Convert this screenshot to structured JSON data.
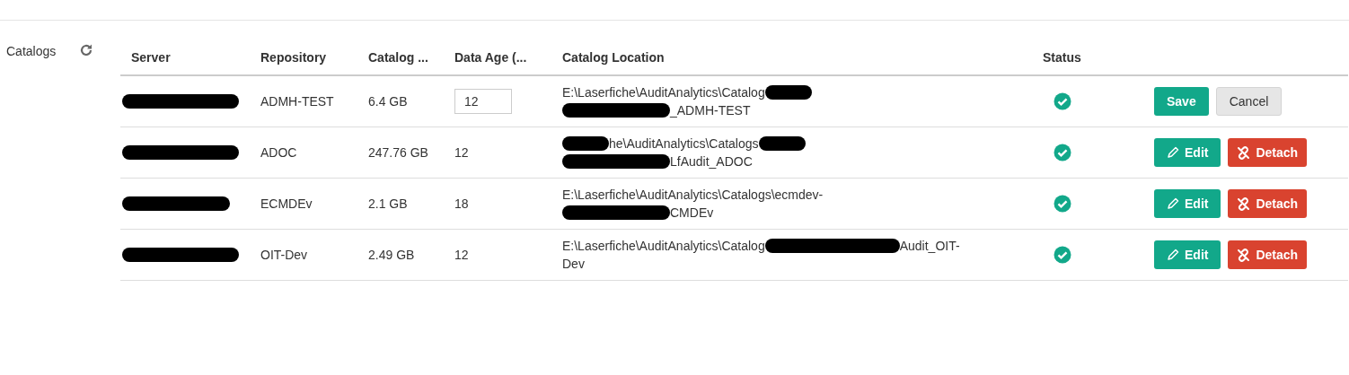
{
  "section": {
    "title": "Catalogs"
  },
  "table": {
    "columns": [
      "Server",
      "Repository",
      "Catalog ...",
      "Data Age (...",
      "Catalog Location",
      "Status"
    ],
    "rows": [
      {
        "server": [
          {
            "kind": "redacted_long"
          }
        ],
        "repository": "ADMH-TEST",
        "catalog_size": "6.4 GB",
        "data_age": "12",
        "editing": true,
        "status_ok": true,
        "location": [
          [
            {
              "kind": "text",
              "text": "E:\\Laserfiche\\AuditAnalytics\\Catalog"
            },
            {
              "kind": "redacted_short"
            }
          ],
          [
            {
              "kind": "redacted_medium"
            },
            {
              "kind": "text",
              "text": "_ADMH-TEST"
            }
          ]
        ],
        "actions": [
          {
            "kind": "save",
            "label": "Save"
          },
          {
            "kind": "cancel",
            "label": "Cancel"
          }
        ]
      },
      {
        "server": [
          {
            "kind": "redacted_long"
          }
        ],
        "repository": "ADOC",
        "catalog_size": "247.76 GB",
        "data_age": "12",
        "editing": false,
        "status_ok": true,
        "location": [
          [
            {
              "kind": "redacted_short"
            },
            {
              "kind": "text",
              "text": "he\\AuditAnalytics\\Catalogs"
            },
            {
              "kind": "redacted_short"
            }
          ],
          [
            {
              "kind": "redacted_medium"
            },
            {
              "kind": "text",
              "text": "LfAudit_ADOC"
            }
          ]
        ],
        "actions": [
          {
            "kind": "edit",
            "label": "Edit"
          },
          {
            "kind": "detach",
            "label": "Detach"
          }
        ]
      },
      {
        "server": [
          {
            "kind": "redacted_medium"
          }
        ],
        "repository": "ECMDEv",
        "catalog_size": "2.1 GB",
        "data_age": "18",
        "editing": false,
        "status_ok": true,
        "location": [
          [
            {
              "kind": "text",
              "text": "E:\\Laserfiche\\AuditAnalytics\\Catalogs\\ecmdev-"
            }
          ],
          [
            {
              "kind": "redacted_medium"
            },
            {
              "kind": "text",
              "text": "CMDEv"
            }
          ]
        ],
        "actions": [
          {
            "kind": "edit",
            "label": "Edit"
          },
          {
            "kind": "detach",
            "label": "Detach"
          }
        ]
      },
      {
        "server": [
          {
            "kind": "redacted_long"
          }
        ],
        "repository": "OIT-Dev",
        "catalog_size": "2.49 GB",
        "data_age": "12",
        "editing": false,
        "status_ok": true,
        "location": [
          [
            {
              "kind": "text",
              "text": "E:\\Laserfiche\\AuditAnalytics\\Catalog"
            },
            {
              "kind": "redacted_long"
            },
            {
              "kind": "text",
              "text": "Audit_OIT-"
            }
          ],
          [
            {
              "kind": "text",
              "text": "Dev"
            }
          ]
        ],
        "actions": [
          {
            "kind": "edit",
            "label": "Edit"
          },
          {
            "kind": "detach",
            "label": "Detach"
          }
        ]
      }
    ]
  }
}
